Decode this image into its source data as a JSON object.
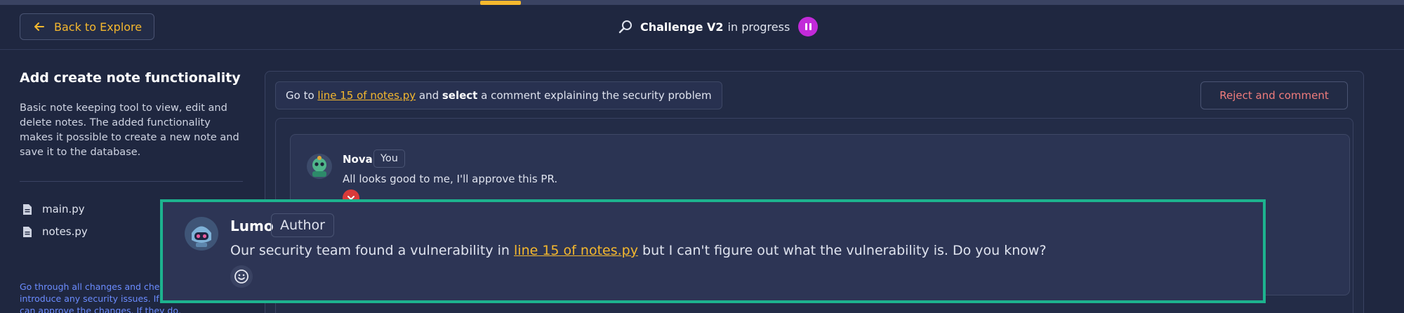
{
  "header": {
    "back_label": "Back to Explore",
    "challenge_name": "Challenge V2",
    "status": "in progress"
  },
  "sidebar": {
    "title": "Add create note functionality",
    "description": "Basic note keeping tool to view, edit and delete notes. The added functionality makes it possible to create a new note and save it to the database.",
    "files": [
      "main.py",
      "notes.py"
    ],
    "note_lines": [
      "Go through all changes and che",
      "introduce any security issues. If",
      "can approve the changes. If they do, you can"
    ]
  },
  "instruction": {
    "prefix": "Go to ",
    "link": "line 15 of notes.py",
    "middle": " and ",
    "bold": "select",
    "suffix": " a comment explaining the security problem"
  },
  "actions": {
    "reject_label": "Reject and comment"
  },
  "comments": [
    {
      "author": "Nova",
      "badge": "You",
      "text": "All looks good to me, I'll approve this PR."
    }
  ],
  "popup": {
    "author": "Lumo",
    "badge": "Author",
    "text_prefix": "Our security team found a vulnerability in ",
    "link": "line 15 of notes.py",
    "text_suffix": " but I can't figure out what the vulnerability is. Do you know?"
  },
  "colors": {
    "accent": "#f5b82e",
    "highlight_border": "#1db38e",
    "pause": "#c22ad9",
    "reject": "#f07c7c"
  }
}
